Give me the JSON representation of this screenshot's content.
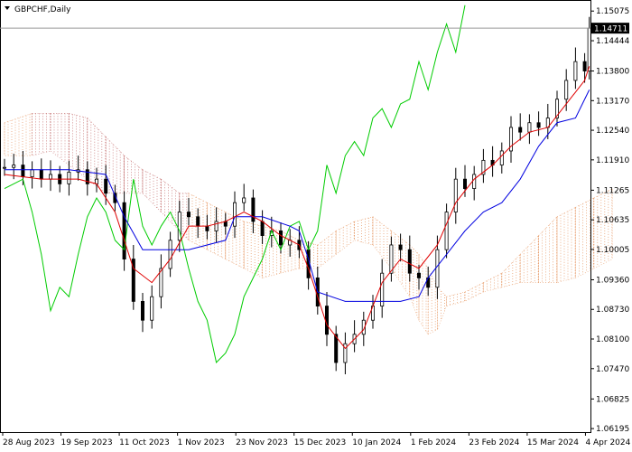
{
  "chart_data": {
    "type": "candlestick",
    "symbol_label": "GBPCHF,Daily",
    "current_price_label": "1.14711",
    "y_ticks": [
      "1.15075",
      "1.14444",
      "1.13800",
      "1.13170",
      "1.12540",
      "1.11910",
      "1.11265",
      "1.10635",
      "1.10005",
      "1.09360",
      "1.08730",
      "1.08100",
      "1.07470",
      "1.06825",
      "1.06195"
    ],
    "x_ticks": [
      "28 Aug 2023",
      "19 Sep 2023",
      "11 Oct 2023",
      "1 Nov 2023",
      "23 Nov 2023",
      "15 Dec 2023",
      "10 Jan 2024",
      "1 Feb 2024",
      "23 Feb 2024",
      "15 Mar 2024",
      "4 Apr 2024"
    ],
    "ylim": [
      1.0612,
      1.1531
    ],
    "colors": {
      "tenkan": "#e00000",
      "kijun": "#0000e0",
      "chikou": "#00cc00",
      "cloud_up": "#c87878",
      "cloud_down": "#e8a070",
      "candles": "#000000"
    },
    "close_path": [
      [
        0,
        1.1175
      ],
      [
        2,
        1.118
      ],
      [
        4,
        1.1155
      ],
      [
        6,
        1.117
      ],
      [
        8,
        1.115
      ],
      [
        10,
        1.116
      ],
      [
        12,
        1.114
      ],
      [
        14,
        1.1165
      ],
      [
        16,
        1.117
      ],
      [
        18,
        1.114
      ],
      [
        20,
        1.115
      ],
      [
        22,
        1.112
      ],
      [
        24,
        1.11
      ],
      [
        26,
        1.098
      ],
      [
        28,
        1.089
      ],
      [
        30,
        1.085
      ],
      [
        32,
        1.09
      ],
      [
        34,
        1.096
      ],
      [
        36,
        1.102
      ],
      [
        38,
        1.108
      ],
      [
        40,
        1.107
      ],
      [
        42,
        1.105
      ],
      [
        44,
        1.104
      ],
      [
        46,
        1.106
      ],
      [
        48,
        1.105
      ],
      [
        50,
        1.11
      ],
      [
        52,
        1.111
      ],
      [
        54,
        1.106
      ],
      [
        56,
        1.103
      ],
      [
        58,
        1.104
      ],
      [
        60,
        1.101
      ],
      [
        62,
        1.102
      ],
      [
        64,
        1.1
      ],
      [
        66,
        1.094
      ],
      [
        68,
        1.088
      ],
      [
        70,
        1.082
      ],
      [
        72,
        1.076
      ],
      [
        74,
        1.08
      ],
      [
        76,
        1.082
      ],
      [
        78,
        1.085
      ],
      [
        80,
        1.088
      ],
      [
        82,
        1.095
      ],
      [
        84,
        1.101
      ],
      [
        86,
        1.1
      ],
      [
        88,
        1.095
      ],
      [
        90,
        1.094
      ],
      [
        92,
        1.092
      ],
      [
        94,
        1.1
      ],
      [
        96,
        1.108
      ],
      [
        98,
        1.115
      ],
      [
        100,
        1.113
      ],
      [
        102,
        1.116
      ],
      [
        104,
        1.119
      ],
      [
        106,
        1.118
      ],
      [
        108,
        1.121
      ],
      [
        110,
        1.126
      ],
      [
        112,
        1.125
      ],
      [
        114,
        1.127
      ],
      [
        116,
        1.126
      ],
      [
        118,
        1.128
      ],
      [
        120,
        1.132
      ],
      [
        122,
        1.136
      ],
      [
        124,
        1.14
      ],
      [
        126,
        1.138
      ],
      [
        127,
        1.1471
      ]
    ],
    "tenkan": [
      [
        0,
        1.116
      ],
      [
        8,
        1.115
      ],
      [
        16,
        1.115
      ],
      [
        20,
        1.114
      ],
      [
        24,
        1.108
      ],
      [
        28,
        1.096
      ],
      [
        32,
        1.093
      ],
      [
        36,
        1.098
      ],
      [
        40,
        1.105
      ],
      [
        44,
        1.105
      ],
      [
        48,
        1.106
      ],
      [
        52,
        1.108
      ],
      [
        56,
        1.106
      ],
      [
        60,
        1.103
      ],
      [
        64,
        1.101
      ],
      [
        66,
        1.096
      ],
      [
        70,
        1.084
      ],
      [
        74,
        1.079
      ],
      [
        78,
        1.083
      ],
      [
        82,
        1.093
      ],
      [
        86,
        1.098
      ],
      [
        90,
        1.096
      ],
      [
        94,
        1.101
      ],
      [
        98,
        1.11
      ],
      [
        102,
        1.115
      ],
      [
        106,
        1.118
      ],
      [
        110,
        1.122
      ],
      [
        114,
        1.125
      ],
      [
        118,
        1.126
      ],
      [
        122,
        1.131
      ],
      [
        126,
        1.136
      ],
      [
        127,
        1.139
      ]
    ],
    "kijun": [
      [
        0,
        1.117
      ],
      [
        14,
        1.117
      ],
      [
        22,
        1.116
      ],
      [
        26,
        1.107
      ],
      [
        30,
        1.1
      ],
      [
        40,
        1.1
      ],
      [
        48,
        1.102
      ],
      [
        50,
        1.107
      ],
      [
        56,
        1.107
      ],
      [
        62,
        1.105
      ],
      [
        64,
        1.104
      ],
      [
        66,
        1.098
      ],
      [
        68,
        1.091
      ],
      [
        74,
        1.089
      ],
      [
        80,
        1.089
      ],
      [
        86,
        1.089
      ],
      [
        90,
        1.09
      ],
      [
        92,
        1.094
      ],
      [
        96,
        1.099
      ],
      [
        100,
        1.104
      ],
      [
        104,
        1.108
      ],
      [
        108,
        1.11
      ],
      [
        112,
        1.115
      ],
      [
        116,
        1.122
      ],
      [
        120,
        1.127
      ],
      [
        124,
        1.128
      ],
      [
        127,
        1.134
      ]
    ],
    "chikou": [
      [
        0,
        1.113
      ],
      [
        4,
        1.115
      ],
      [
        6,
        1.108
      ],
      [
        8,
        1.099
      ],
      [
        10,
        1.087
      ],
      [
        12,
        1.092
      ],
      [
        14,
        1.09
      ],
      [
        16,
        1.099
      ],
      [
        18,
        1.107
      ],
      [
        20,
        1.111
      ],
      [
        22,
        1.108
      ],
      [
        24,
        1.102
      ],
      [
        26,
        1.1
      ],
      [
        28,
        1.115
      ],
      [
        30,
        1.105
      ],
      [
        32,
        1.101
      ],
      [
        34,
        1.105
      ],
      [
        36,
        1.108
      ],
      [
        38,
        1.104
      ],
      [
        40,
        1.096
      ],
      [
        42,
        1.089
      ],
      [
        44,
        1.085
      ],
      [
        46,
        1.076
      ],
      [
        48,
        1.078
      ],
      [
        50,
        1.082
      ],
      [
        52,
        1.09
      ],
      [
        54,
        1.094
      ],
      [
        56,
        1.098
      ],
      [
        58,
        1.104
      ],
      [
        60,
        1.1
      ],
      [
        62,
        1.105
      ],
      [
        64,
        1.106
      ],
      [
        66,
        1.1
      ],
      [
        68,
        1.104
      ],
      [
        70,
        1.118
      ],
      [
        72,
        1.112
      ],
      [
        74,
        1.12
      ],
      [
        76,
        1.123
      ],
      [
        78,
        1.12
      ],
      [
        80,
        1.128
      ],
      [
        82,
        1.13
      ],
      [
        84,
        1.126
      ],
      [
        86,
        1.131
      ],
      [
        88,
        1.132
      ],
      [
        90,
        1.14
      ],
      [
        92,
        1.134
      ],
      [
        94,
        1.142
      ],
      [
        96,
        1.148
      ],
      [
        98,
        1.142
      ],
      [
        100,
        1.152
      ]
    ],
    "cloud": [
      [
        0,
        1.127,
        1.12
      ],
      [
        6,
        1.129,
        1.12
      ],
      [
        10,
        1.129,
        1.121
      ],
      [
        14,
        1.129,
        1.118
      ],
      [
        18,
        1.128,
        1.115
      ],
      [
        22,
        1.124,
        1.112
      ],
      [
        26,
        1.12,
        1.112
      ],
      [
        30,
        1.117,
        1.112
      ],
      [
        34,
        1.115,
        1.108
      ],
      [
        38,
        1.112,
        1.104
      ],
      [
        40,
        1.112,
        1.102
      ],
      [
        44,
        1.11,
        1.1
      ],
      [
        48,
        1.108,
        1.098
      ],
      [
        52,
        1.106,
        1.096
      ],
      [
        56,
        1.105,
        1.094
      ],
      [
        60,
        1.104,
        1.095
      ],
      [
        64,
        1.102,
        1.096
      ],
      [
        68,
        1.101,
        1.096
      ],
      [
        72,
        1.104,
        1.099
      ],
      [
        76,
        1.106,
        1.102
      ],
      [
        80,
        1.107,
        1.101
      ],
      [
        84,
        1.104,
        1.096
      ],
      [
        88,
        1.101,
        1.09
      ],
      [
        90,
        1.099,
        1.085
      ],
      [
        92,
        1.096,
        1.082
      ],
      [
        94,
        1.092,
        1.083
      ],
      [
        96,
        1.09,
        1.088
      ],
      [
        100,
        1.091,
        1.089
      ],
      [
        104,
        1.093,
        1.091
      ],
      [
        108,
        1.095,
        1.092
      ],
      [
        112,
        1.099,
        1.093
      ],
      [
        116,
        1.103,
        1.093
      ],
      [
        120,
        1.107,
        1.093
      ],
      [
        124,
        1.109,
        1.094
      ],
      [
        128,
        1.111,
        1.096
      ],
      [
        132,
        1.113,
        1.098
      ]
    ]
  }
}
